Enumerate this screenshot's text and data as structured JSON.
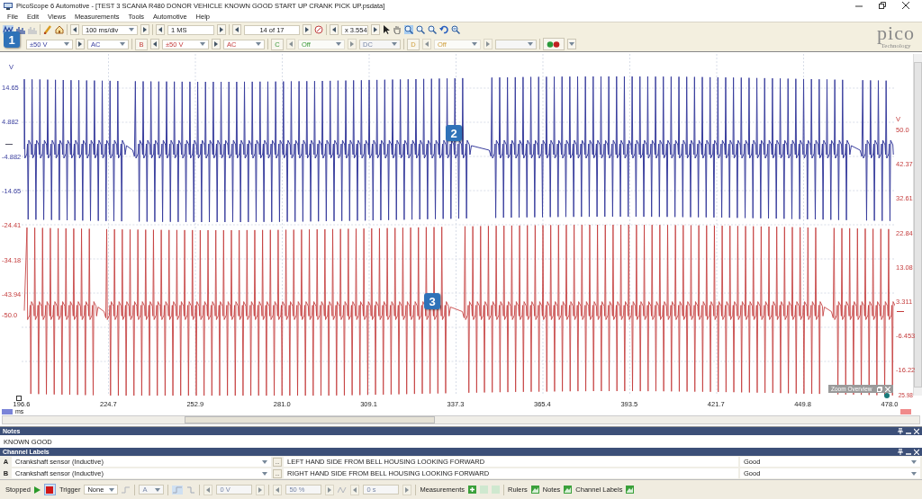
{
  "window": {
    "title": "PicoScope 6 Automotive - [TEST 3 SCANIA R480 DONOR VEHICLE KNOWN GOOD START UP CRANK PICK UP.psdata]"
  },
  "menu": [
    "File",
    "Edit",
    "Views",
    "Measurements",
    "Tools",
    "Automotive",
    "Help"
  ],
  "toolbar": {
    "timebase": "100 ms/div",
    "samples": "1 MS",
    "buffer": "14 of 17",
    "zoom": "x 3.554"
  },
  "logo": {
    "name": "pico",
    "tagline": "Technology"
  },
  "channels": [
    {
      "range": "±50 V",
      "coupling": "AC",
      "enabled": true
    },
    {
      "letter": "B",
      "range": "±50 V",
      "coupling": "AC",
      "enabled": true
    },
    {
      "letter": "C",
      "range": "Off",
      "coupling": "DC",
      "enabled": false
    },
    {
      "letter": "D",
      "range": "Off",
      "enabled": false
    }
  ],
  "callouts": [
    "1",
    "2",
    "3"
  ],
  "scope": {
    "left_axis": {
      "unit": "V",
      "channel_a_labels": [
        "14.65",
        "4.882",
        "-4.882",
        "-14.65"
      ],
      "channel_b_labels": [
        "-24.41",
        "-34.18",
        "-43.94",
        "-50.0"
      ]
    },
    "right_axis": {
      "unit": "V",
      "labels": [
        "50.0",
        "42.37",
        "32.61",
        "22.84",
        "13.08",
        "3.311",
        "-6.453",
        "-16.22"
      ],
      "end_label": "25.98"
    },
    "x_axis": {
      "unit": "ms",
      "labels": [
        "196.6",
        "224.7",
        "252.9",
        "281.0",
        "309.1",
        "337.3",
        "365.4",
        "393.5",
        "421.7",
        "449.8",
        "478.0"
      ]
    },
    "zoom_overview": "Zoom Overview"
  },
  "notes": {
    "title": "Notes",
    "text": "KNOWN GOOD"
  },
  "channel_labels": {
    "title": "Channel Labels",
    "rows": [
      {
        "letter": "A",
        "probe": "Crankshaft sensor (Inductive)",
        "label": "LEFT HAND SIDE FROM BELL HOUSING LOOKING FORWARD",
        "status": "Good",
        "more_button": "..."
      },
      {
        "letter": "B",
        "probe": "Crankshaft sensor (Inductive)",
        "label": "RIGHT HAND SIDE FROM BELL HOUSING LOOKING FORWARD",
        "status": "Good",
        "more_button": "..."
      }
    ]
  },
  "status_bar": {
    "state": "Stopped",
    "trigger_label": "Trigger",
    "trigger_mode": "None",
    "trigger_channel": "A",
    "threshold": "0 V",
    "pretrigger": "50 %",
    "delay": "0 s",
    "toggles": [
      "Measurements",
      "Rulers",
      "Notes",
      "Channel Labels"
    ]
  }
}
